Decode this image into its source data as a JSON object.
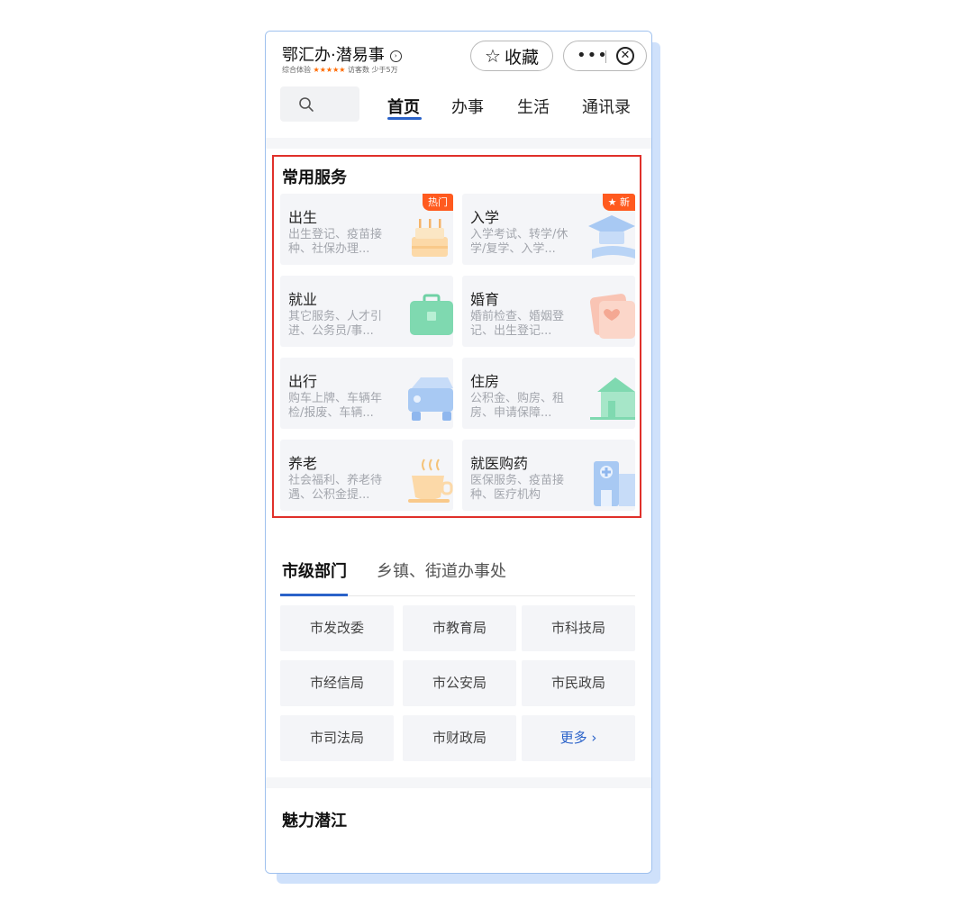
{
  "header": {
    "app_title": "鄂汇办·潜易事",
    "title_arrow": "›",
    "rating_label": "综合体验",
    "rating_stars": "★★★★★",
    "visitors_label": "访客数 少于5万",
    "favorite_icon": "star-outline-icon",
    "favorite_label": "收藏",
    "more_dots": "•••",
    "close_glyph": "✕"
  },
  "nav": {
    "tabs": [
      {
        "label": "首页",
        "active": true
      },
      {
        "label": "办事",
        "active": false
      },
      {
        "label": "生活",
        "active": false
      },
      {
        "label": "通讯录",
        "active": false
      }
    ]
  },
  "services": {
    "title": "常用服务",
    "items": [
      {
        "title": "出生",
        "desc": "出生登记、疫苗接种、社保办理...",
        "badge": "热门",
        "icon": "cake-icon"
      },
      {
        "title": "入学",
        "desc": "入学考试、转学/休学/复学、入学...",
        "badge": "★ 新",
        "icon": "graduation-cap-icon"
      },
      {
        "title": "就业",
        "desc": "其它服务、人才引进、公务员/事...",
        "badge": "",
        "icon": "briefcase-icon"
      },
      {
        "title": "婚育",
        "desc": "婚前检查、婚姻登记、出生登记...",
        "badge": "",
        "icon": "marriage-certificate-icon"
      },
      {
        "title": "出行",
        "desc": "购车上牌、车辆年检/报废、车辆...",
        "badge": "",
        "icon": "car-icon"
      },
      {
        "title": "住房",
        "desc": "公积金、购房、租房、申请保障...",
        "badge": "",
        "icon": "house-icon"
      },
      {
        "title": "养老",
        "desc": "社会福利、养老待遇、公积金提...",
        "badge": "",
        "icon": "tea-cup-icon"
      },
      {
        "title": "就医购药",
        "desc": "医保服务、疫苗接种、医疗机构",
        "badge": "",
        "icon": "hospital-icon"
      }
    ]
  },
  "departments": {
    "tabs": [
      {
        "label": "市级部门",
        "active": true
      },
      {
        "label": "乡镇、街道办事处",
        "active": false
      }
    ],
    "items": [
      "市发改委",
      "市教育局",
      "市科技局",
      "市经信局",
      "市公安局",
      "市民政局",
      "市司法局",
      "市财政局"
    ],
    "more_label": "更多 ›"
  },
  "charm": {
    "title": "魅力潜江"
  },
  "colors": {
    "accent": "#2a62c9",
    "badge": "#ff5a1f",
    "highlight_frame": "#e0302a"
  }
}
